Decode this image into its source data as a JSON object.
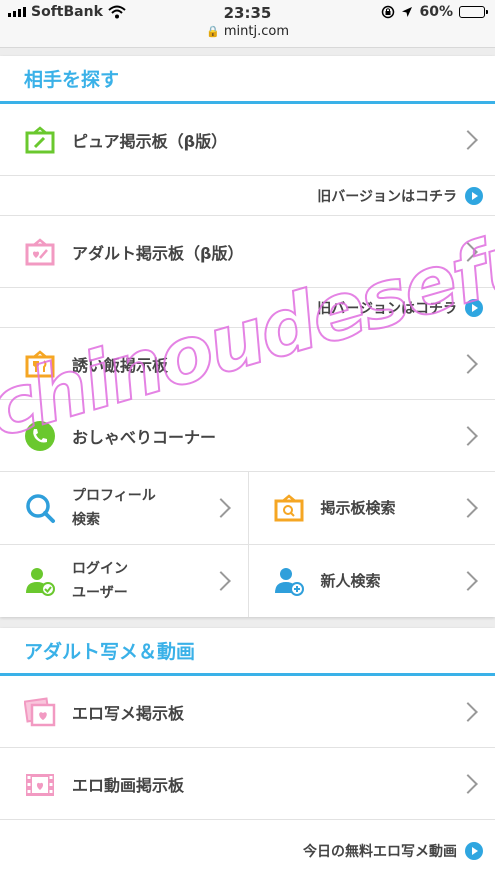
{
  "status_bar": {
    "carrier": "SoftBank",
    "time": "23:35",
    "battery": "60%",
    "battery_level": 0.6,
    "url": "mintj.com"
  },
  "section1": {
    "title": "相手を探す",
    "items": [
      {
        "label": "ピュア掲示板（β版）",
        "icon": "pure-board-icon"
      },
      {
        "label": "アダルト掲示板（β版）",
        "icon": "adult-board-icon"
      },
      {
        "label": "誘い飯掲示板",
        "icon": "meal-board-icon"
      },
      {
        "label": "おしゃべりコーナー",
        "icon": "phone-icon"
      }
    ],
    "old_version_link": "旧バージョンはコチラ",
    "grid": [
      {
        "line1": "プロフィール",
        "line2": "検索",
        "icon": "search-icon"
      },
      {
        "label": "掲示板検索",
        "icon": "board-search-icon"
      },
      {
        "line1": "ログイン",
        "line2": "ユーザー",
        "icon": "login-user-icon"
      },
      {
        "label": "新人検索",
        "icon": "new-user-icon"
      }
    ]
  },
  "section2": {
    "title": "アダルト写メ＆動画",
    "items": [
      {
        "label": "エロ写メ掲示板",
        "icon": "photo-board-icon"
      },
      {
        "label": "エロ動画掲示板",
        "icon": "video-board-icon"
      }
    ],
    "today_link": "今日の無料エロ写メ動画"
  },
  "watermark": "chinoudesefuregetnet",
  "colors": {
    "accent": "#3ab1e8",
    "green": "#6ac82e",
    "pink": "#f29ac2",
    "orange": "#f5a623",
    "blue": "#2f9fdb"
  }
}
